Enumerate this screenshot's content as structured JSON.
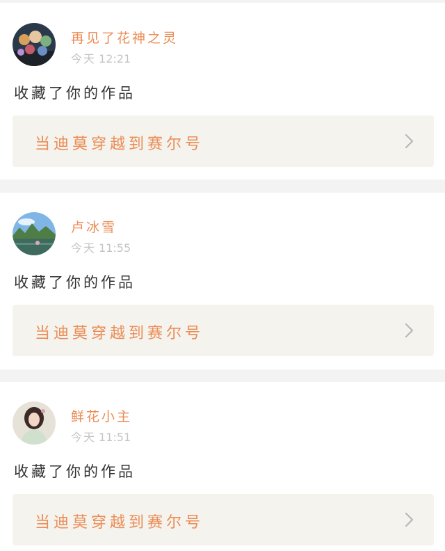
{
  "colors": {
    "accent": "#ec8c55",
    "card_background": "#ffffff",
    "page_background": "#f3f3f3",
    "work_box_background": "#f4f3ee",
    "timestamp": "#c4c4c4",
    "action_text": "#333333"
  },
  "notifications": [
    {
      "username": "再见了花神之灵",
      "time_day": "今天",
      "time_clock": "12:21",
      "action": "收藏了你的作品",
      "work_title": "当迪莫穿越到赛尔号",
      "avatar_icon": "cartoon-group-avatar-icon"
    },
    {
      "username": "卢冰雪",
      "time_day": "今天",
      "time_clock": "11:55",
      "action": "收藏了你的作品",
      "work_title": "当迪莫穿越到赛尔号",
      "avatar_icon": "landscape-avatar-icon"
    },
    {
      "username": "鲜花小主",
      "time_day": "今天",
      "time_clock": "11:51",
      "action": "收藏了你的作品",
      "work_title": "当迪莫穿越到赛尔号",
      "avatar_icon": "girl-portrait-avatar-icon"
    }
  ]
}
